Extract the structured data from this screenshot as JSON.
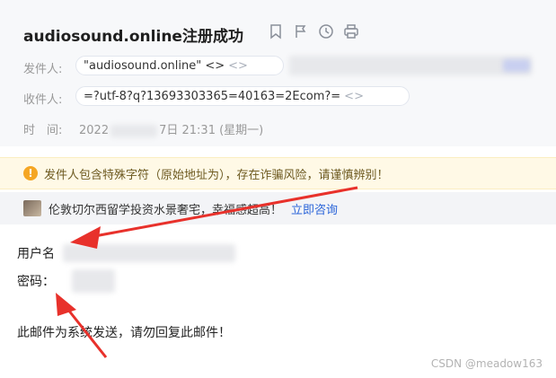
{
  "email": {
    "subject": "audiosound.online注册成功",
    "from_label": "发件人:",
    "from_value": "\"audiosound.online\" <>",
    "from_tag": "<>",
    "to_label": "收件人:",
    "to_value": "=?utf-8?q?13693303365=40163=2Ecom?=",
    "to_tag": "<>",
    "time_label": "时　间:",
    "time_value_start": "2022",
    "time_value_end": "7日 21:31 (星期一)"
  },
  "warning": {
    "icon": "!",
    "text": "发件人包含特殊字符（原始地址为），存在诈骗风险，请谨慎辨别！"
  },
  "ad": {
    "text": "伦敦切尔西留学投资水景奢宅，幸福感超高！",
    "link": "立即咨询"
  },
  "body": {
    "username_label": "用户名",
    "password_label": "密码：",
    "note": "此邮件为系统发送，请勿回复此邮件！"
  },
  "watermark": "CSDN @meadow163",
  "icons": [
    "bookmark-icon",
    "flag-icon",
    "clock-icon",
    "print-icon",
    "warning-icon",
    "ad-thumbnail"
  ],
  "colors": {
    "warn_bg": "#fff9e6",
    "warn_icon": "#f5a623",
    "link": "#2b65d9",
    "arrow": "#e8312b"
  }
}
